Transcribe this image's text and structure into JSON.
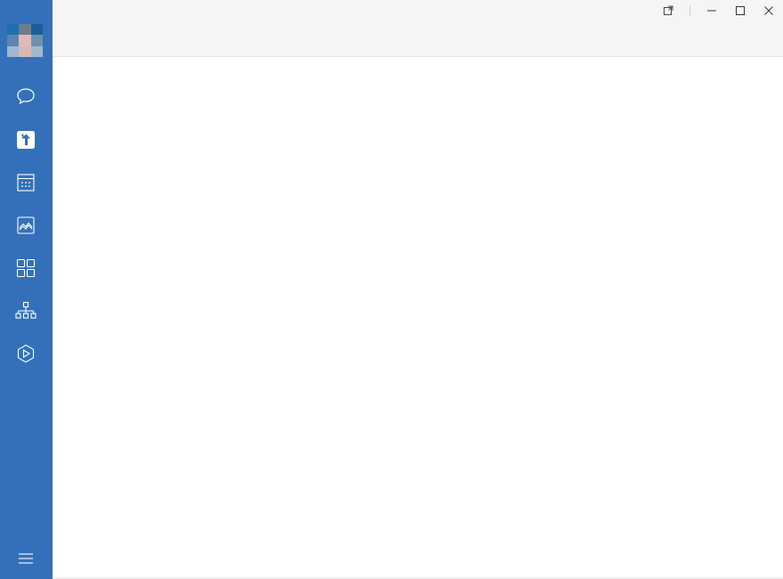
{
  "app": {
    "window_title": ""
  },
  "colors": {
    "sidebar": "#3470b9",
    "titlebar": "#f5f5f5",
    "content": "#ffffff",
    "icon_stroke": "#ffffff"
  },
  "avatar": {
    "pixels": [
      "#1f6fb0",
      "#6b7d8f",
      "#1a5e96",
      "#5a86b0",
      "#e0b9b8",
      "#6e8fad",
      "#9db8cf",
      "#d8b7bb",
      "#a4b9cc"
    ]
  },
  "sidebar": {
    "items": [
      {
        "name": "chat",
        "icon": "chat-bubble-icon",
        "active": false
      },
      {
        "name": "upload",
        "icon": "upload-arrow-icon",
        "active": true
      },
      {
        "name": "calendar",
        "icon": "calendar-icon",
        "active": false
      },
      {
        "name": "gallery",
        "icon": "image-gallery-icon",
        "active": false
      },
      {
        "name": "apps",
        "icon": "apps-grid-icon",
        "active": false
      },
      {
        "name": "organization",
        "icon": "org-chart-icon",
        "active": false
      },
      {
        "name": "play",
        "icon": "hexagon-play-icon",
        "active": false
      }
    ],
    "menu_icon": "hamburger-menu-icon"
  },
  "window_controls": [
    "pin-icon",
    "minimize-icon",
    "maximize-icon",
    "close-icon"
  ]
}
